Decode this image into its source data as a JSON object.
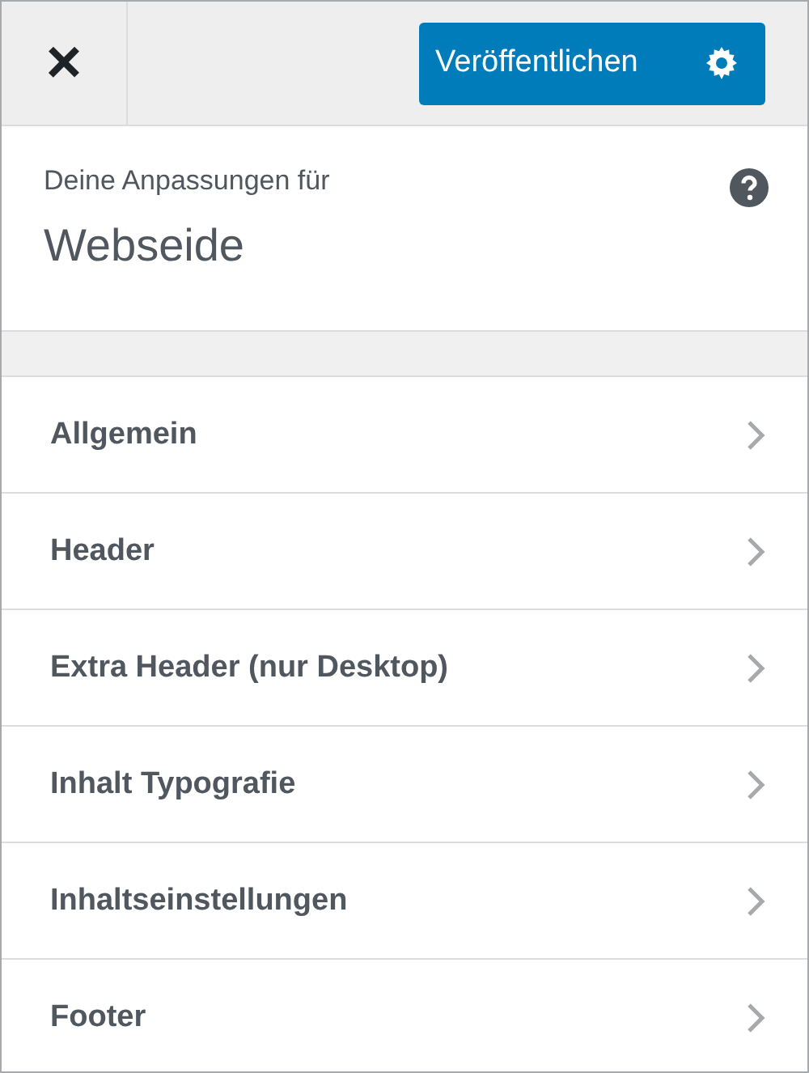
{
  "header": {
    "close_label": "×",
    "publish_button": "Veröffentlichen"
  },
  "info": {
    "subtitle": "Deine Anpassungen für",
    "title": "Webseide"
  },
  "sections": [
    {
      "label": "Allgemein"
    },
    {
      "label": "Header"
    },
    {
      "label": "Extra Header (nur Desktop)"
    },
    {
      "label": "Inhalt Typografie"
    },
    {
      "label": "Inhaltseinstellungen"
    },
    {
      "label": "Footer"
    }
  ]
}
